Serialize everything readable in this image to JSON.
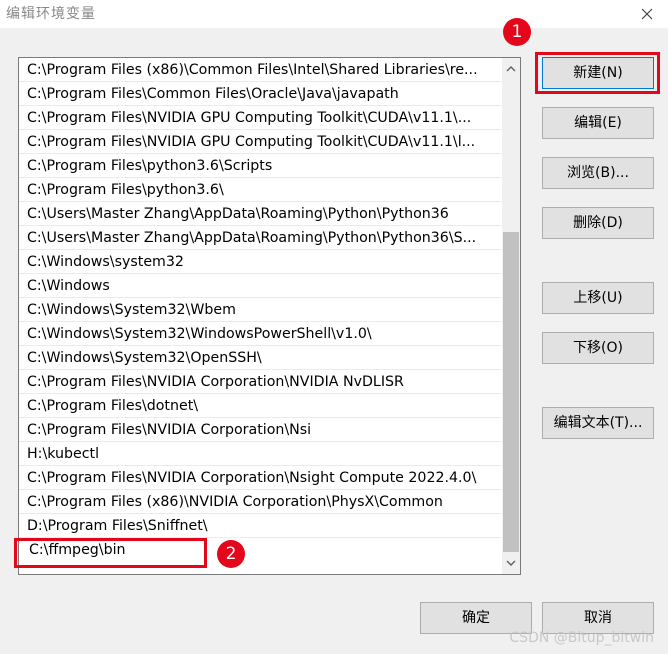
{
  "window": {
    "title": "编辑环境变量"
  },
  "path_list": [
    "C:\\Program Files (x86)\\Common Files\\Intel\\Shared Libraries\\re...",
    "C:\\Program Files\\Common Files\\Oracle\\Java\\javapath",
    "C:\\Program Files\\NVIDIA GPU Computing Toolkit\\CUDA\\v11.1\\...",
    "C:\\Program Files\\NVIDIA GPU Computing Toolkit\\CUDA\\v11.1\\l...",
    "C:\\Program Files\\python3.6\\Scripts",
    "C:\\Program Files\\python3.6\\",
    "C:\\Users\\Master Zhang\\AppData\\Roaming\\Python\\Python36",
    "C:\\Users\\Master Zhang\\AppData\\Roaming\\Python\\Python36\\S...",
    "C:\\Windows\\system32",
    "C:\\Windows",
    "C:\\Windows\\System32\\Wbem",
    "C:\\Windows\\System32\\WindowsPowerShell\\v1.0\\",
    "C:\\Windows\\System32\\OpenSSH\\",
    "C:\\Program Files\\NVIDIA Corporation\\NVIDIA NvDLISR",
    "C:\\Program Files\\dotnet\\",
    "C:\\Program Files\\NVIDIA Corporation\\Nsi",
    "H:\\kubectl",
    "C:\\Program Files\\NVIDIA Corporation\\Nsight Compute 2022.4.0\\",
    "C:\\Program Files (x86)\\NVIDIA Corporation\\PhysX\\Common",
    "D:\\Program Files\\Sniffnet\\"
  ],
  "editing_entry": {
    "value": "C:\\ffmpeg\\bin"
  },
  "buttons": {
    "new": "新建(N)",
    "edit": "编辑(E)",
    "browse": "浏览(B)...",
    "delete": "删除(D)",
    "move_up": "上移(U)",
    "move_down": "下移(O)",
    "edit_text": "编辑文本(T)...",
    "ok": "确定",
    "cancel": "取消"
  },
  "annotations": {
    "step1": "1",
    "step2": "2",
    "color": "#e4061a"
  },
  "watermark": "CSDN @Bitup_bitwin"
}
